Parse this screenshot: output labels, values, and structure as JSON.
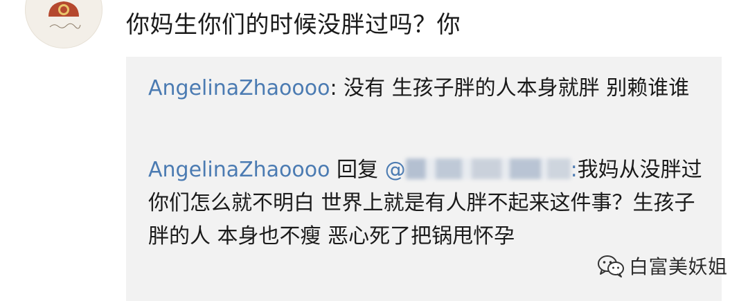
{
  "post": {
    "comment_text": "你妈生你们的时候没胖过吗？你"
  },
  "replies": [
    {
      "username": "AngelinaZhaoooo",
      "separator": ": ",
      "text": "没有 生孩子胖的人本身就胖 别赖谁谁"
    },
    {
      "username": "AngelinaZhaoooo",
      "reply_word": " 回复 ",
      "mention_prefix": "@",
      "mention_suffix": ":",
      "text": "我妈从没胖过 你们怎么就不明白 世界上就是有人胖不起来这件事？生孩子胖的人 本身也不瘦 恶心死了把锅甩怀孕"
    }
  ],
  "watermark": {
    "text": "白富美妖姐",
    "icon": "wechat-icon"
  },
  "colors": {
    "username": "#4b7bb2",
    "body_text": "#1a1a1a",
    "reply_box_bg": "#f2f2f2"
  }
}
